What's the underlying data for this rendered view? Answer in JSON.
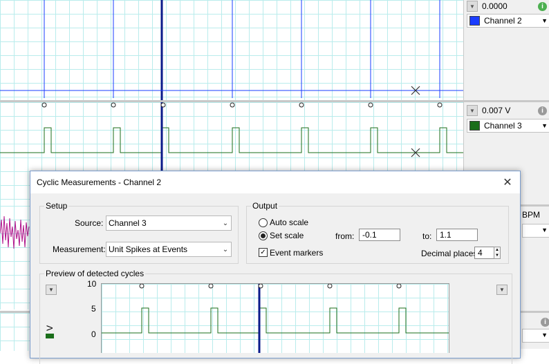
{
  "channels": [
    {
      "value": "0.0000",
      "name": "Channel 2",
      "color": "#1a3cff"
    },
    {
      "value": "0.007 V",
      "name": "Channel 3",
      "color": "#1a6e1a"
    },
    {
      "value": "BPM"
    }
  ],
  "dialog": {
    "title": "Cyclic Measurements - Channel 2",
    "setup": {
      "group_label": "Setup",
      "source_label": "Source:",
      "source_value": "Channel 3",
      "measurement_label": "Measurement:",
      "measurement_value": "Unit Spikes at Events"
    },
    "output": {
      "group_label": "Output",
      "auto_scale_label": "Auto scale",
      "set_scale_label": "Set scale",
      "selected_scale": "set",
      "from_label": "from:",
      "from_value": "-0.1",
      "to_label": "to:",
      "to_value": "1.1",
      "event_markers_label": "Event markers",
      "event_markers_checked": true,
      "decimal_places_label": "Decimal places:",
      "decimal_places_value": "4"
    },
    "preview": {
      "group_label": "Preview of detected cycles",
      "y_ticks": [
        "10",
        "5",
        "0"
      ],
      "unit_label": "V"
    }
  },
  "colors": {
    "accent_blue": "#1a3cff",
    "trace_green": "#1a6e1a",
    "trace_magenta": "#b0108a",
    "grid": "#b9ecec"
  }
}
